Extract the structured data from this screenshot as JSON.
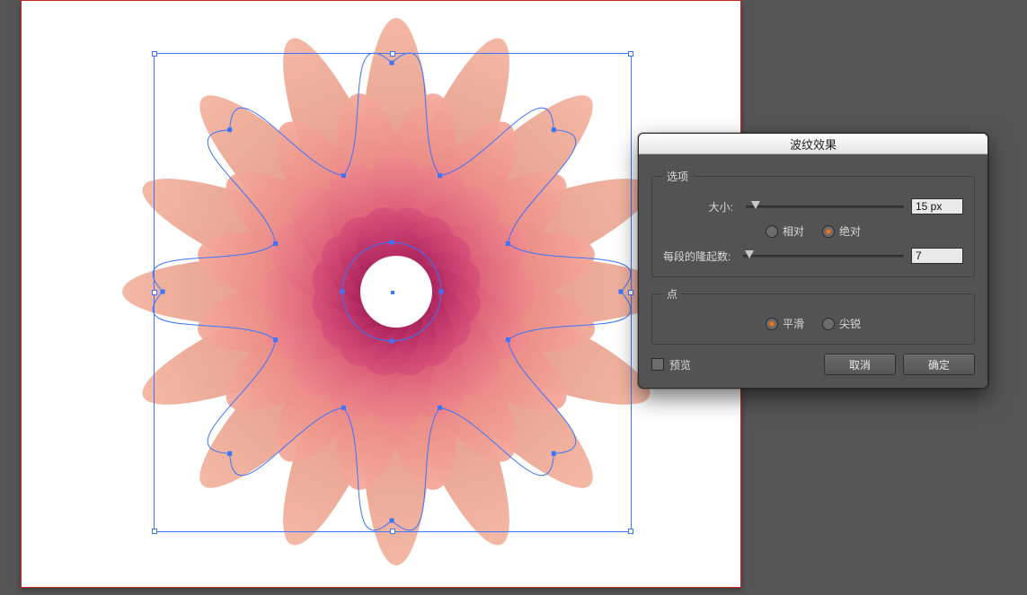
{
  "canvas": {
    "artboard_border_color": "#c72a1f",
    "selection_color": "#3a74ff"
  },
  "artwork": {
    "description": "radial flower blend",
    "petal_count": 16,
    "colors": {
      "outer_light": "#f2b39d",
      "outer_dark": "#d7776e",
      "inner_light": "#ef8e8e",
      "inner_dark": "#8e1952"
    }
  },
  "dialog": {
    "title": "波纹效果",
    "options_group": {
      "legend": "选项",
      "size": {
        "label": "大小:",
        "value": "15 px",
        "slider_percent": 6
      },
      "mode": {
        "relative": "相对",
        "absolute": "绝对",
        "selected": "absolute"
      },
      "ridges": {
        "label": "每段的隆起数:",
        "value": "7",
        "slider_percent": 4
      }
    },
    "points_group": {
      "legend": "点",
      "smooth": "平滑",
      "corner": "尖锐",
      "selected": "smooth"
    },
    "preview_label": "预览",
    "preview_checked": false,
    "cancel": "取消",
    "ok": "确定"
  }
}
